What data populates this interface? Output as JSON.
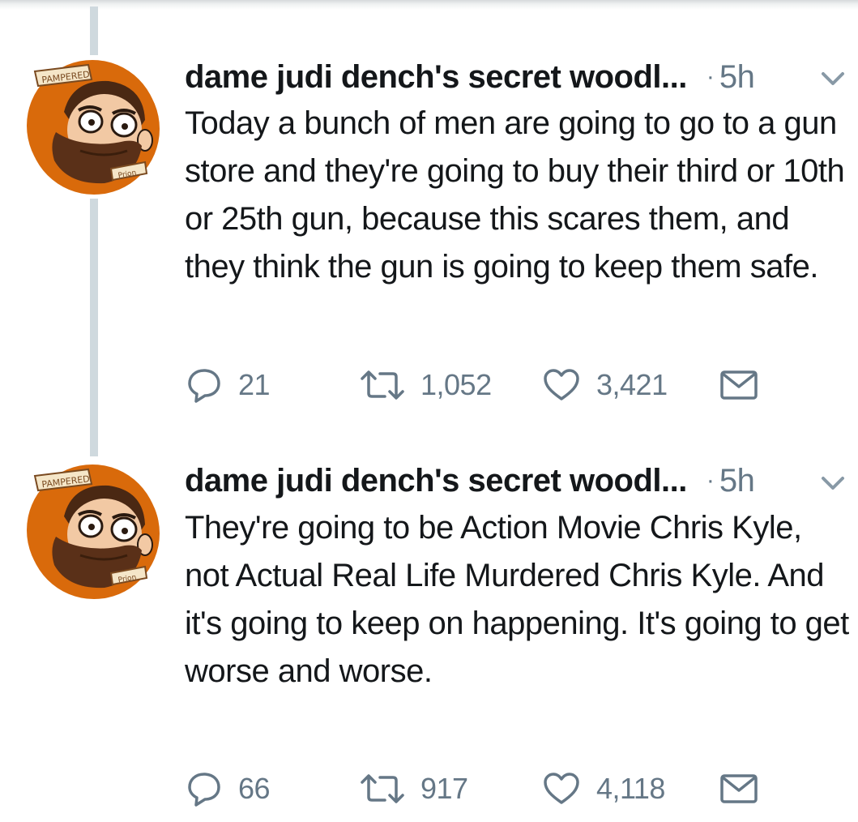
{
  "tweets": [
    {
      "author": "dame judi dench's secret woodl...",
      "separator": "·",
      "time": "5h",
      "avatar_badge_top": "PAMPERED",
      "avatar_badge_bottom": "Prion",
      "text": "Today a bunch of men are going to go to a gun store and they're going to buy their third or 10th or 25th gun, because this scares them, and they think the gun is going to keep them safe.",
      "replies": "21",
      "retweets": "1,052",
      "likes": "3,421"
    },
    {
      "author": "dame judi dench's secret woodl...",
      "separator": "·",
      "time": "5h",
      "avatar_badge_top": "PAMPERED",
      "avatar_badge_bottom": "Prion",
      "text": "They're going to be Action Movie Chris Kyle, not Actual Real Life Murdered Chris Kyle. And it's going to keep on happening. It's going to get worse and worse.",
      "replies": "66",
      "retweets": "917",
      "likes": "4,118"
    }
  ],
  "colors": {
    "text": "#14171a",
    "secondary": "#657786",
    "thread_line": "#cfd9de",
    "avatar_bg": "#d96a0b"
  },
  "icons": [
    "reply-icon",
    "retweet-icon",
    "like-icon",
    "direct-message-icon",
    "chevron-down-icon"
  ]
}
